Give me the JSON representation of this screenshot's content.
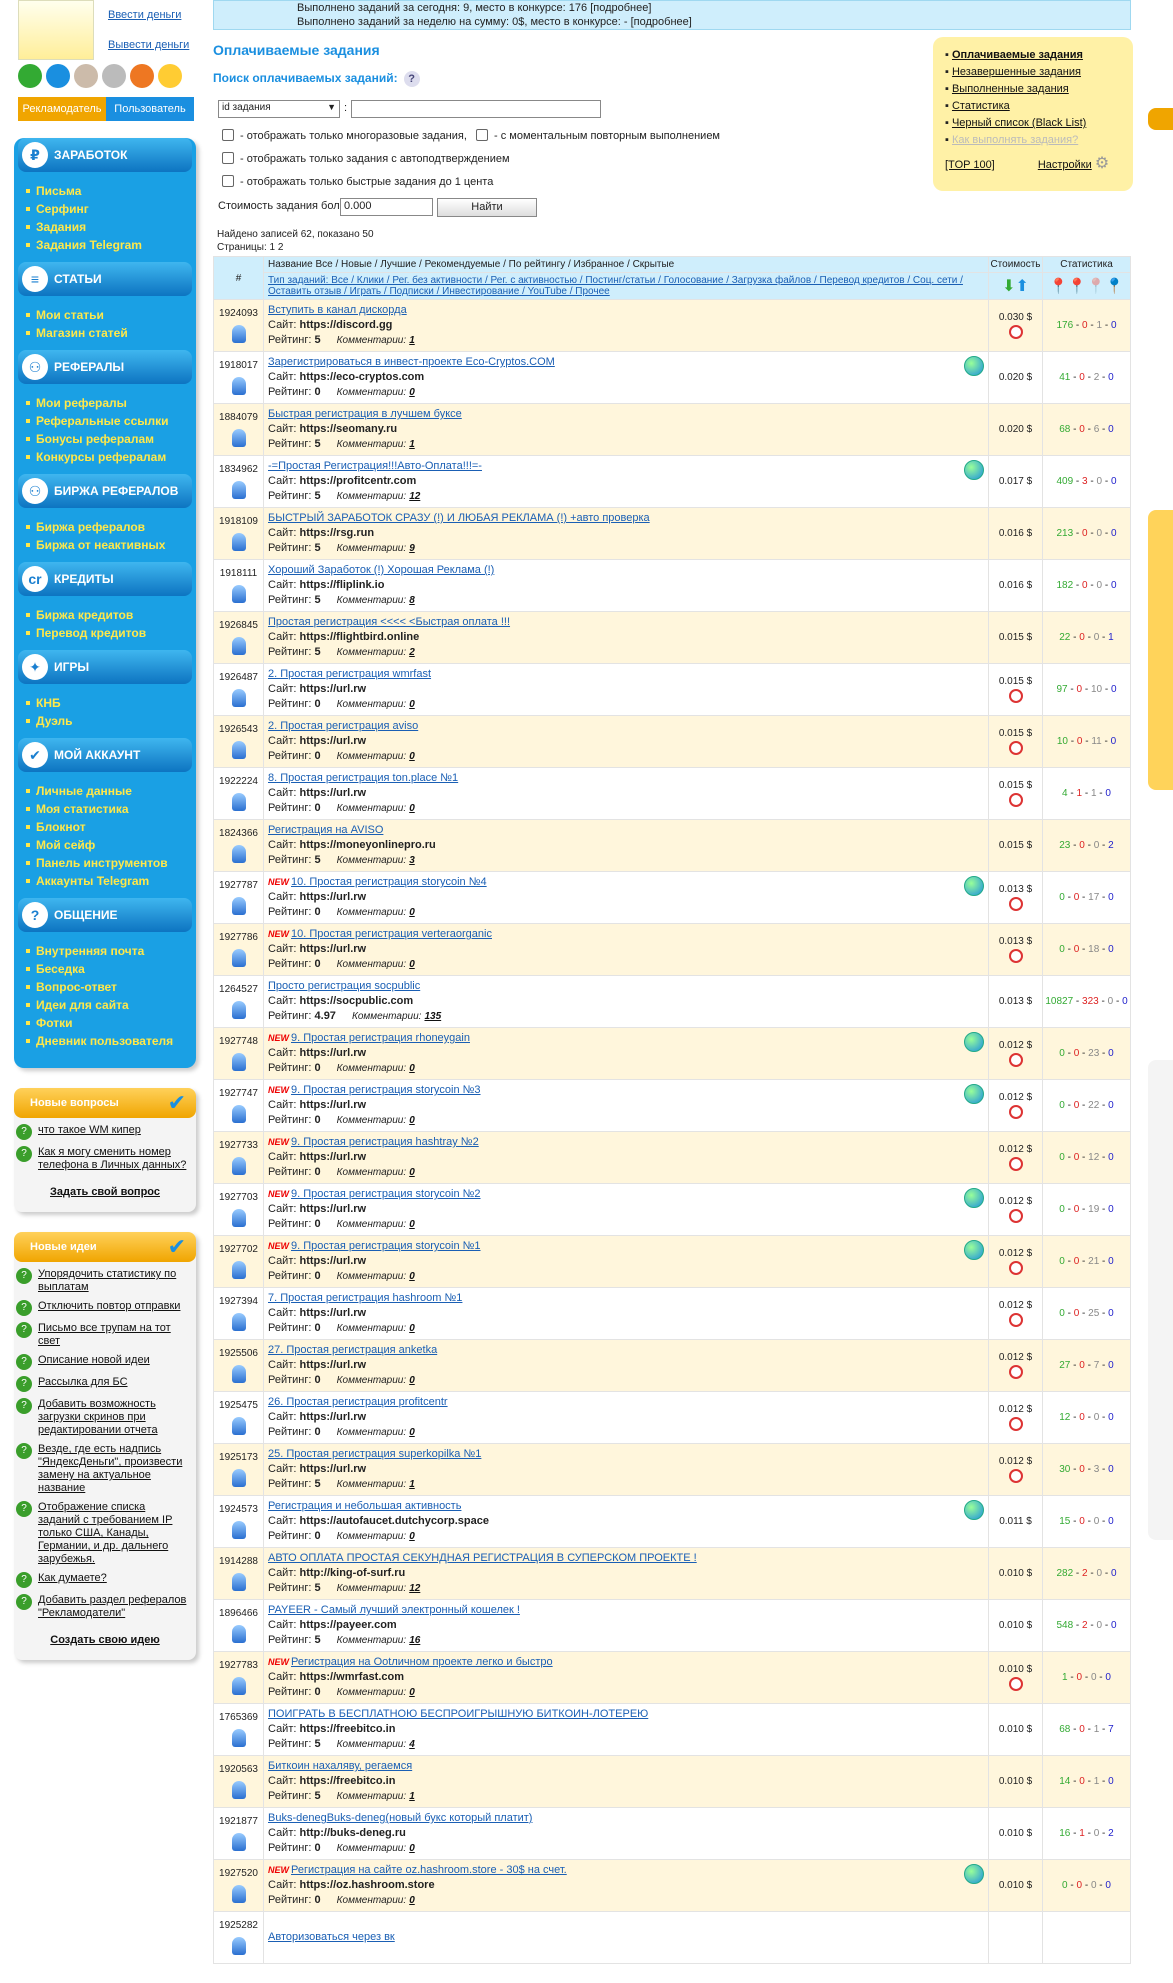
{
  "left": {
    "logo_links": [
      "Ввести деньги",
      "Вывести деньги"
    ],
    "roles": [
      "Рекламодатель",
      "Пользователь"
    ],
    "menu": [
      {
        "title": "ЗАРАБОТОК",
        "items": [
          "Письма",
          "Серфинг",
          "Задания",
          "Задания Telegram"
        ]
      },
      {
        "title": "СТАТЬИ",
        "items": [
          "Мои статьи",
          "Магазин статей"
        ]
      },
      {
        "title": "РЕФЕРАЛЫ",
        "items": [
          "Мои рефералы",
          "Реферальные ссылки",
          "Бонусы рефералам",
          "Конкурсы рефералам"
        ]
      },
      {
        "title": "БИРЖА РЕФЕРАЛОВ",
        "items": [
          "Биржа рефералов",
          "Биржа от неактивных"
        ]
      },
      {
        "title": "КРЕДИТЫ",
        "items": [
          "Биржа кредитов",
          "Перевод кредитов"
        ]
      },
      {
        "title": "ИГРЫ",
        "items": [
          "КНБ",
          "Дуэль"
        ]
      },
      {
        "title": "МОЙ АККАУНТ",
        "items": [
          "Личные данные",
          "Моя статистика",
          "Блокнот",
          "Мой сейф",
          "Панель инструментов",
          "Аккаунты Telegram"
        ]
      },
      {
        "title": "ОБЩЕНИЕ",
        "items": [
          "Внутренняя почта",
          "Беседка",
          "Вопрос-ответ",
          "Идеи для сайта",
          "Фотки",
          "Дневник пользователя"
        ]
      }
    ],
    "questions": {
      "title": "Новые вопросы",
      "items": [
        "что такое WM кипер",
        "Как я могу сменить номер телефона в Личных данных?"
      ],
      "footer": "Задать свой вопрос"
    },
    "ideas": {
      "title": "Новые идеи",
      "items": [
        "Упорядочить статистику по выплатам",
        "Отключить повтор отправки",
        "Письмо все трупам на тот свет",
        "Описание новой идеи",
        "Рассылка для БС",
        "Добавить возможность загрузки скринов при редактировании отчета",
        "Везде, где есть надпись \"ЯндексДеньги\", произвести замену на актуальное название",
        "Отображение списка заданий с требованием IP только США, Канады, Германии, и др. дальнего зарубежья.",
        "Как думаете?",
        "Добавить раздел рефералов \"Рекламодатели\""
      ],
      "footer": "Создать свою идею"
    }
  },
  "stat": {
    "line1": "Выполнено заданий за сегодня: 9, место в конкурсе: 176 [подробнее]",
    "line2": "Выполнено заданий за неделю на сумму: 0$, место в конкурсе: - [подробнее]"
  },
  "page_title": "Оплачиваемые задания",
  "search": {
    "title": "Поиск оплачиваемых заданий:",
    "select": "id задания",
    "colon": ":",
    "chk1a": "- отображать только многоразовые задания,",
    "chk1b": "- с моментальным повторным выполнением",
    "chk2": "- отображать только задания с автоподтверждением",
    "chk3": "- отображать только быстрые задания до 1 цента",
    "cost_label": "Стоимость задания больше",
    "cost_value": "0.000",
    "find": "Найти"
  },
  "rbox": [
    "Оплачиваемые задания",
    "Незавершенные задания",
    "Выполненные задания",
    "Статистика",
    "Черный список (Black List)",
    "Как выполнять задания?"
  ],
  "rbox_top": "[TOP 100]",
  "rbox_settings": "Настройки",
  "found": "Найдено записей 62, показано 50",
  "pages": "Страницы: 1 2",
  "header": {
    "hash": "#",
    "name_row": "Название Все / Новые / Лучшие / Рекомендуемые / По рейтингу / Избранное / Скрытые",
    "type_row": "Тип заданий: Все / Клики / Рег. без активности / Рег. с активностью / Постинг/статьи / Голосование / Загрузка файлов / Перевод кредитов / Соц. сети / Оставить отзыв / Играть / Подписки / Инвестирование / YouTube / Прочее",
    "cost": "Стоимость",
    "stats": "Статистика"
  },
  "site_label": "Сайт:",
  "rating_label": "Рейтинг:",
  "comments_label": "Комментарии:",
  "rows": [
    [
      "1924093",
      "Вступить в канал дискорда",
      "https://discord.gg",
      "5",
      "1",
      "0.030 $",
      1,
      0,
      "176",
      "0",
      "1",
      "0",
      0
    ],
    [
      "1918017",
      "Зарегистрироваться в инвест-проекте Eco-Cryptos.COM",
      "https://eco-cryptos.com",
      "0",
      "0",
      "0.020 $",
      0,
      1,
      "41",
      "0",
      "2",
      "0",
      0
    ],
    [
      "1884079",
      "Быстрая регистрация в лучшем буксе",
      "https://seomany.ru",
      "5",
      "1",
      "0.020 $",
      0,
      0,
      "68",
      "0",
      "6",
      "0",
      0
    ],
    [
      "1834962",
      "-=Простая Регистрация!!!Авто-Оплата!!!=-",
      "https://profitcentr.com",
      "5",
      "12",
      "0.017 $",
      0,
      1,
      "409",
      "3",
      "0",
      "0",
      0
    ],
    [
      "1918109",
      "БЫСТРЫЙ ЗАРАБОТОК СРАЗУ (!) И ЛЮБАЯ РЕКЛАМА (!) +авто проверка",
      "https://rsg.run",
      "5",
      "9",
      "0.016 $",
      0,
      0,
      "213",
      "0",
      "0",
      "0",
      0
    ],
    [
      "1918111",
      "Хороший Заработок (!) Хорошая Реклама (!)",
      "https://fliplink.io",
      "5",
      "8",
      "0.016 $",
      0,
      0,
      "182",
      "0",
      "0",
      "0",
      0
    ],
    [
      "1926845",
      "Простая регистрация <<<< <Быстрая оплата !!!",
      "https://flightbird.online",
      "5",
      "2",
      "0.015 $",
      0,
      0,
      "22",
      "0",
      "0",
      "1",
      0
    ],
    [
      "1926487",
      "2. Простая регистрация wmrfast",
      "https://url.rw",
      "0",
      "0",
      "0.015 $",
      1,
      0,
      "97",
      "0",
      "10",
      "0",
      0
    ],
    [
      "1926543",
      "2. Простая регистрация aviso",
      "https://url.rw",
      "0",
      "0",
      "0.015 $",
      1,
      0,
      "10",
      "0",
      "11",
      "0",
      0
    ],
    [
      "1922224",
      "8. Простая регистрация ton.place №1",
      "https://url.rw",
      "0",
      "0",
      "0.015 $",
      1,
      0,
      "4",
      "1",
      "1",
      "0",
      0
    ],
    [
      "1824366",
      "Регистрация на AVISO",
      "https://moneyonlinepro.ru",
      "5",
      "3",
      "0.015 $",
      0,
      0,
      "23",
      "0",
      "0",
      "2",
      0
    ],
    [
      "1927787",
      "10. Простая регистрация storycoin №4",
      "https://url.rw",
      "0",
      "0",
      "0.013 $",
      1,
      1,
      "0",
      "0",
      "17",
      "0",
      1
    ],
    [
      "1927786",
      "10. Простая регистрация verteraorganic",
      "https://url.rw",
      "0",
      "0",
      "0.013 $",
      1,
      0,
      "0",
      "0",
      "18",
      "0",
      1
    ],
    [
      "1264527",
      "Просто регистрация socpublic",
      "https://socpublic.com",
      "4.97",
      "135",
      "0.013 $",
      0,
      0,
      "10827",
      "323",
      "0",
      "0",
      0
    ],
    [
      "1927748",
      "9. Простая регистрация rhoneygain",
      "https://url.rw",
      "0",
      "0",
      "0.012 $",
      1,
      1,
      "0",
      "0",
      "23",
      "0",
      1
    ],
    [
      "1927747",
      "9. Простая регистрация storycoin №3",
      "https://url.rw",
      "0",
      "0",
      "0.012 $",
      1,
      1,
      "0",
      "0",
      "22",
      "0",
      1
    ],
    [
      "1927733",
      "9. Простая регистрация hashtray №2",
      "https://url.rw",
      "0",
      "0",
      "0.012 $",
      1,
      0,
      "0",
      "0",
      "12",
      "0",
      1
    ],
    [
      "1927703",
      "9. Простая регистрация storycoin №2",
      "https://url.rw",
      "0",
      "0",
      "0.012 $",
      1,
      1,
      "0",
      "0",
      "19",
      "0",
      1
    ],
    [
      "1927702",
      "9. Простая регистрация storycoin №1",
      "https://url.rw",
      "0",
      "0",
      "0.012 $",
      1,
      1,
      "0",
      "0",
      "21",
      "0",
      1
    ],
    [
      "1927394",
      "7. Простая регистрация hashroom №1",
      "https://url.rw",
      "0",
      "0",
      "0.012 $",
      1,
      0,
      "0",
      "0",
      "25",
      "0",
      0
    ],
    [
      "1925506",
      "27. Простая регистрация anketka",
      "https://url.rw",
      "0",
      "0",
      "0.012 $",
      1,
      0,
      "27",
      "0",
      "7",
      "0",
      0
    ],
    [
      "1925475",
      "26. Простая регистрация profitcentr",
      "https://url.rw",
      "0",
      "0",
      "0.012 $",
      1,
      0,
      "12",
      "0",
      "0",
      "0",
      0
    ],
    [
      "1925173",
      "25. Простая регистрация superkopilka №1",
      "https://url.rw",
      "5",
      "1",
      "0.012 $",
      1,
      0,
      "30",
      "0",
      "3",
      "0",
      0
    ],
    [
      "1924573",
      "Регистрация и небольшая активность",
      "https://autofaucet.dutchycorp.space",
      "0",
      "0",
      "0.011 $",
      0,
      1,
      "15",
      "0",
      "0",
      "0",
      0
    ],
    [
      "1914288",
      "АВТО ОПЛАТА ПРОСТАЯ СЕКУНДНАЯ РЕГИСТРАЦИЯ В СУПЕРСКОМ ПРОЕКТЕ !",
      "http://king-of-surf.ru",
      "5",
      "12",
      "0.010 $",
      0,
      0,
      "282",
      "2",
      "0",
      "0",
      0
    ],
    [
      "1896466",
      "PAYEER - Самый лучший электронный кошелек !",
      "https://payeer.com",
      "5",
      "16",
      "0.010 $",
      0,
      0,
      "548",
      "2",
      "0",
      "0",
      0
    ],
    [
      "1927783",
      "Регистрация на Ootличном проекте легко и быстро",
      "https://wmrfast.com",
      "0",
      "0",
      "0.010 $",
      1,
      0,
      "1",
      "0",
      "0",
      "0",
      1
    ],
    [
      "1765369",
      "ПОИГРАТЬ В БЕСПЛАТНОЮ БЕСПРОИГРЫШНУЮ БИТКОИН-ЛОТЕРЕЮ",
      "https://freebitco.in",
      "5",
      "4",
      "0.010 $",
      0,
      0,
      "68",
      "0",
      "1",
      "7",
      0
    ],
    [
      "1920563",
      "Биткоин нахаляву, регаемся",
      "https://freebitco.in",
      "5",
      "1",
      "0.010 $",
      0,
      0,
      "14",
      "0",
      "1",
      "0",
      0
    ],
    [
      "1921877",
      "Buks-denegBuks-deneg(новый букс который платит)",
      "http://buks-deneg.ru",
      "0",
      "0",
      "0.010 $",
      0,
      0,
      "16",
      "1",
      "0",
      "2",
      0
    ],
    [
      "1927520",
      "Регистрация на сайте oz.hashroom.store - 30$ на счет.",
      "https://oz.hashroom.store",
      "0",
      "0",
      "0.010 $",
      0,
      1,
      "0",
      "0",
      "0",
      "0",
      1
    ],
    [
      "1925282",
      "Авторизоваться через вк",
      "",
      "",
      "",
      "",
      "",
      0,
      "",
      "",
      "",
      "",
      0
    ]
  ]
}
